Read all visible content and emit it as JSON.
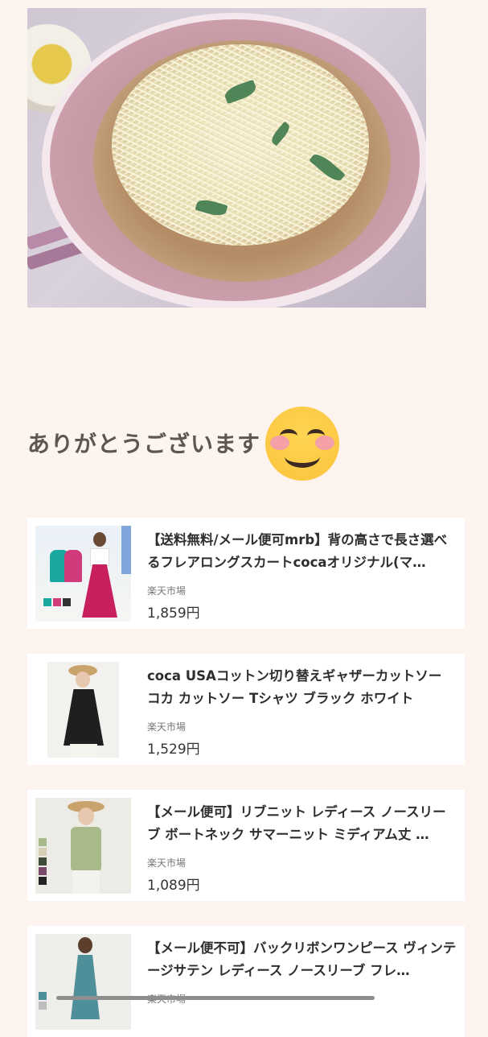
{
  "heading": {
    "text": "ありがとうございます",
    "emoji": "smiling-face-with-blush-icon"
  },
  "products": [
    {
      "title": "【送料無料/メール便可mrb】背の高さで長さ選べるフレアロングスカートcocaオリジナル(マ…",
      "shop": "楽天市場",
      "price": "1,859円",
      "thumb": "flare-long-skirt-photo"
    },
    {
      "title": "coca USAコットン切り替えギャザーカットソー コカ カットソー Tシャツ ブラック ホワイト",
      "shop": "楽天市場",
      "price": "1,529円",
      "thumb": "black-gather-cutsew-photo"
    },
    {
      "title": "【メール便可】リブニット レディース ノースリーブ ボートネック サマーニット ミディアム丈 …",
      "shop": "楽天市場",
      "price": "1,089円",
      "thumb": "rib-knit-sleeveless-photo"
    },
    {
      "title": "【メール便不可】バックリボンワンピース ヴィンテージサテン レディース ノースリーブ フレ…",
      "shop": "楽天市場",
      "price": "",
      "thumb": "back-ribbon-dress-photo"
    }
  ],
  "colors": {
    "page_bg": "#fdf4f0",
    "card_bg": "#ffffff",
    "heading": "#5f5652"
  }
}
